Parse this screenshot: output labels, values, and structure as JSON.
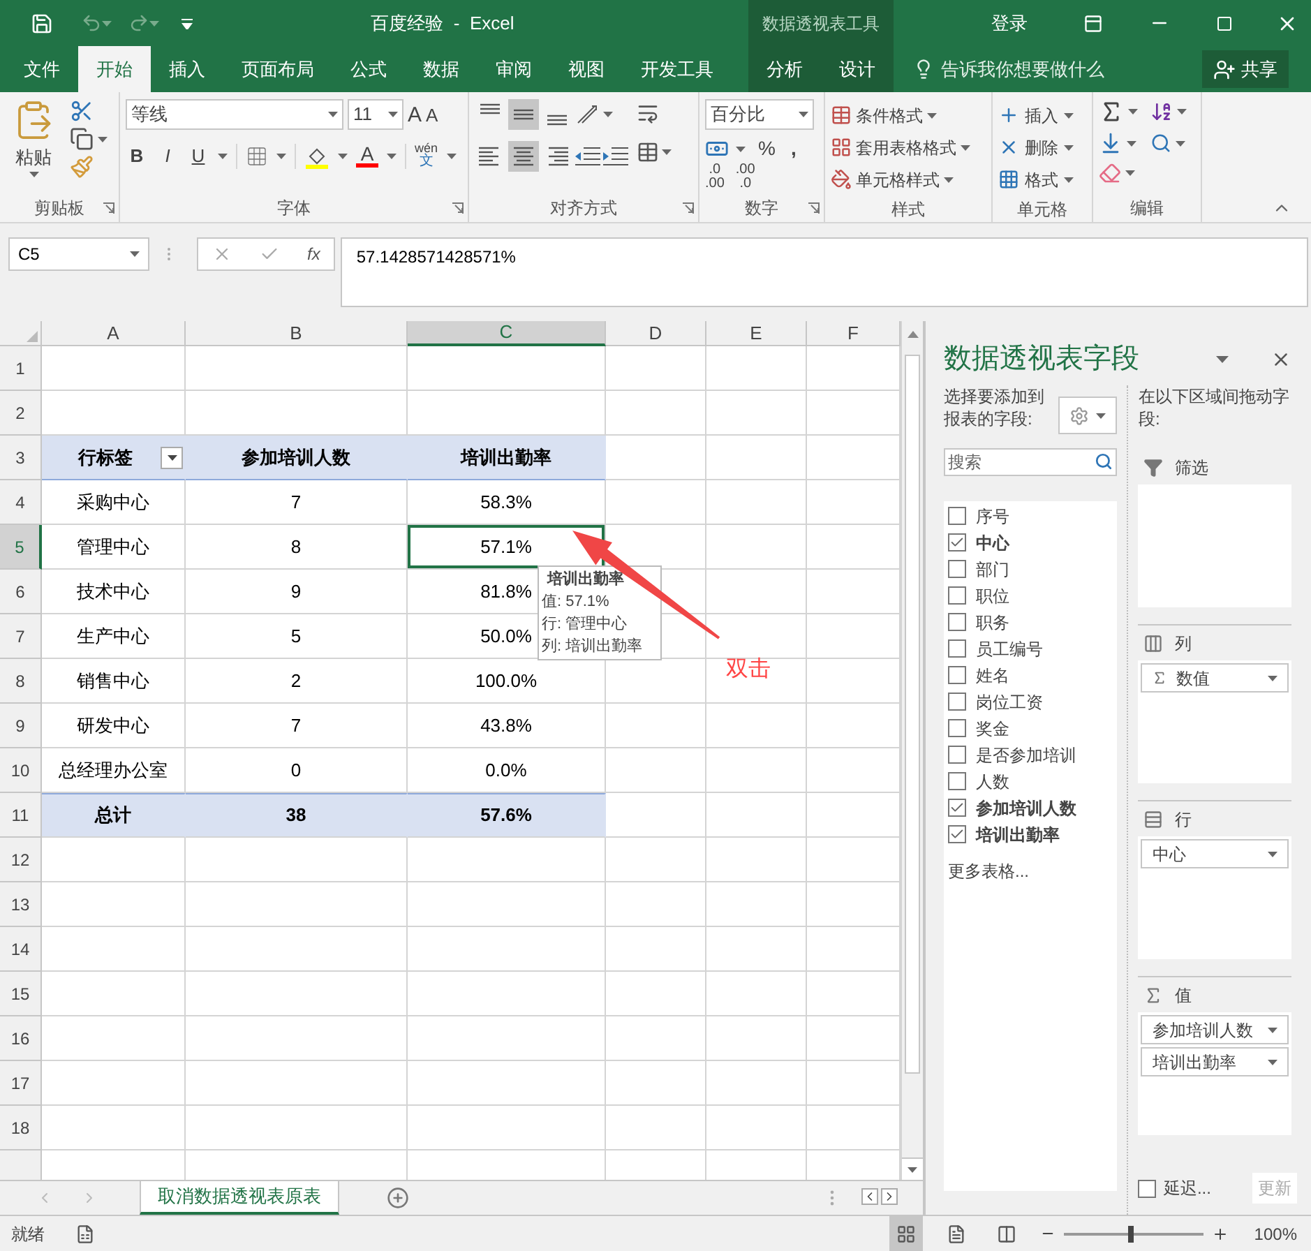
{
  "title_bar": {
    "title": "百度经验  -  Excel",
    "context_label": "数据透视表工具",
    "sign_in": "登录"
  },
  "ribbon_tabs": [
    {
      "label": "文件",
      "selected": false
    },
    {
      "label": "开始",
      "selected": true
    },
    {
      "label": "插入",
      "selected": false
    },
    {
      "label": "页面布局",
      "selected": false
    },
    {
      "label": "公式",
      "selected": false
    },
    {
      "label": "数据",
      "selected": false
    },
    {
      "label": "审阅",
      "selected": false
    },
    {
      "label": "视图",
      "selected": false
    },
    {
      "label": "开发工具",
      "selected": false
    }
  ],
  "context_tabs": [
    {
      "label": "分析",
      "selected": false
    },
    {
      "label": "设计",
      "selected": false
    }
  ],
  "tell_me": "告诉我你想要做什么",
  "share": "共享",
  "ribbon": {
    "clipboard": {
      "paste": "粘贴",
      "label": "剪贴板"
    },
    "font": {
      "name": "等线",
      "size": "11",
      "grow": "A",
      "shrink": "A",
      "bold": "B",
      "italic": "I",
      "underline": "U",
      "font_color": "A",
      "phonetic_top": "wén",
      "phonetic_bottom": "文",
      "label": "字体"
    },
    "alignment": {
      "label": "对齐方式",
      "vertical": [
        {
          "selected": false
        },
        {
          "selected": true
        },
        {
          "selected": false
        }
      ],
      "horizontal": [
        {
          "selected": false
        },
        {
          "selected": true
        },
        {
          "selected": false
        }
      ]
    },
    "number": {
      "format": "百分比",
      "percent": "%",
      "comma": ",",
      "increase_decimal": [
        ".0",
        ".00"
      ],
      "decrease_decimal": [
        ".00",
        ".0"
      ],
      "label": "数字"
    },
    "styles": {
      "items": [
        "条件格式",
        "套用表格格式",
        "单元格样式"
      ],
      "label": "样式"
    },
    "cells": {
      "items": [
        "插入",
        "删除",
        "格式"
      ],
      "label": "单元格"
    },
    "editing": {
      "label": "编辑"
    }
  },
  "formula_bar": {
    "name_box": "C5",
    "fx": "fx",
    "value": "57.1428571428571%"
  },
  "sheet": {
    "columns": [
      {
        "label": "A",
        "selected": false
      },
      {
        "label": "B",
        "selected": false
      },
      {
        "label": "C",
        "selected": true
      },
      {
        "label": "D",
        "selected": false
      },
      {
        "label": "E",
        "selected": false
      },
      {
        "label": "F",
        "selected": false
      }
    ],
    "rows": [
      {
        "label": "1",
        "selected": false,
        "kind": "blank"
      },
      {
        "label": "2",
        "selected": false,
        "kind": "blank"
      },
      {
        "label": "3",
        "selected": false,
        "kind": "header",
        "cells": [
          "行标签",
          "参加培训人数",
          "培训出勤率"
        ]
      },
      {
        "label": "4",
        "selected": false,
        "kind": "data",
        "cells": [
          "采购中心",
          "7",
          "58.3%"
        ]
      },
      {
        "label": "5",
        "selected": true,
        "kind": "data",
        "cells": [
          "管理中心",
          "8",
          "57.1%"
        ]
      },
      {
        "label": "6",
        "selected": false,
        "kind": "data",
        "cells": [
          "技术中心",
          "9",
          "81.8%"
        ]
      },
      {
        "label": "7",
        "selected": false,
        "kind": "data",
        "cells": [
          "生产中心",
          "5",
          "50.0%"
        ]
      },
      {
        "label": "8",
        "selected": false,
        "kind": "data",
        "cells": [
          "销售中心",
          "2",
          "100.0%"
        ]
      },
      {
        "label": "9",
        "selected": false,
        "kind": "data",
        "cells": [
          "研发中心",
          "7",
          "43.8%"
        ]
      },
      {
        "label": "10",
        "selected": false,
        "kind": "data",
        "cells": [
          "总经理办公室",
          "0",
          "0.0%"
        ]
      },
      {
        "label": "11",
        "selected": false,
        "kind": "total",
        "cells": [
          "总计",
          "38",
          "57.6%"
        ]
      },
      {
        "label": "12",
        "selected": false,
        "kind": "blank"
      },
      {
        "label": "13",
        "selected": false,
        "kind": "blank"
      },
      {
        "label": "14",
        "selected": false,
        "kind": "blank"
      },
      {
        "label": "15",
        "selected": false,
        "kind": "blank"
      },
      {
        "label": "16",
        "selected": false,
        "kind": "blank"
      },
      {
        "label": "17",
        "selected": false,
        "kind": "blank"
      },
      {
        "label": "18",
        "selected": false,
        "kind": "blank"
      }
    ],
    "tooltip": {
      "title": "培训出勤率",
      "lines": [
        "值: 57.1%",
        "行: 管理中心",
        "列:  培训出勤率"
      ]
    },
    "annotation": "双击"
  },
  "sheet_tabs": [
    {
      "label": "取消数据透视表原表",
      "selected": true
    }
  ],
  "pivot_pane": {
    "title": "数据透视表字段",
    "choose_label": "选择要添加到报表的字段:",
    "search_placeholder": "搜索",
    "fields": [
      {
        "label": "序号",
        "checked": false
      },
      {
        "label": "中心",
        "checked": true
      },
      {
        "label": "部门",
        "checked": false
      },
      {
        "label": "职位",
        "checked": false
      },
      {
        "label": "职务",
        "checked": false
      },
      {
        "label": "员工编号",
        "checked": false
      },
      {
        "label": "姓名",
        "checked": false
      },
      {
        "label": "岗位工资",
        "checked": false
      },
      {
        "label": "奖金",
        "checked": false
      },
      {
        "label": "是否参加培训",
        "checked": false
      },
      {
        "label": "人数",
        "checked": false
      },
      {
        "label": "参加培训人数",
        "checked": true
      },
      {
        "label": "培训出勤率",
        "checked": true
      }
    ],
    "more_tables": "更多表格...",
    "drag_label": "在以下区域间拖动字段:",
    "areas": [
      {
        "kind": "filter",
        "label": "筛选"
      },
      {
        "kind": "columns",
        "label": "列",
        "items": [
          {
            "label": "数值",
            "sigma": true
          }
        ]
      },
      {
        "kind": "rows",
        "label": "行",
        "items": [
          {
            "label": "中心",
            "sigma": false
          }
        ]
      },
      {
        "kind": "values",
        "label": "值",
        "items": [
          {
            "label": "参加培训人数",
            "sigma": false
          },
          {
            "label": "培训出勤率",
            "sigma": false
          }
        ]
      }
    ],
    "defer": {
      "label": "延迟...",
      "checked": false
    },
    "update": "更新"
  },
  "status_bar": {
    "ready": "就绪",
    "views": [
      {
        "kind": "normal",
        "selected": true
      },
      {
        "kind": "page_layout",
        "selected": false
      },
      {
        "kind": "page_break",
        "selected": false
      }
    ],
    "zoom_slider": {
      "level": 0.48
    },
    "zoom": "100%"
  }
}
